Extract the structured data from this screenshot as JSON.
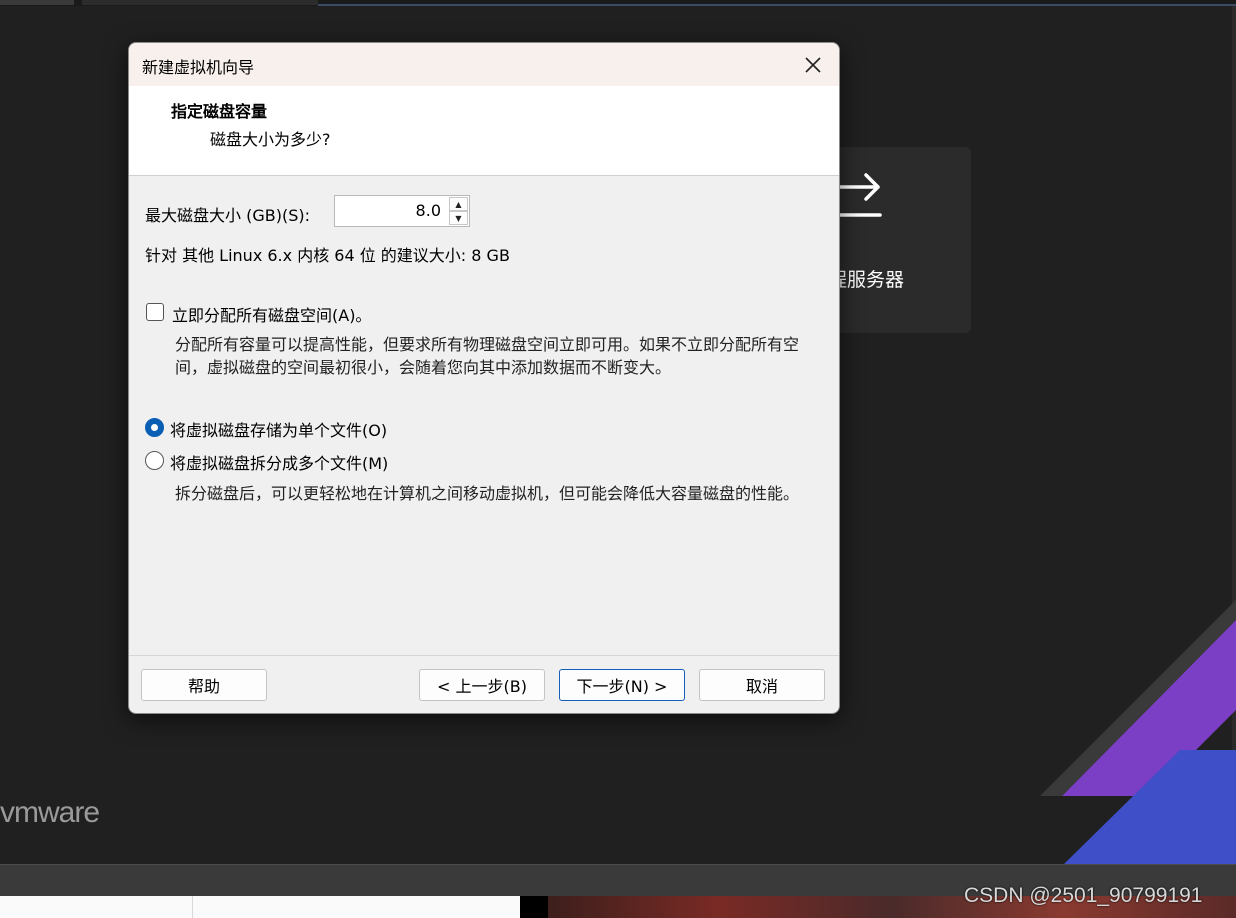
{
  "dialog": {
    "title": "新建虚拟机向导",
    "header_title": "指定磁盘容量",
    "header_subtitle": "磁盘大小为多少?",
    "disk_size_label": "最大磁盘大小 (GB)(S):",
    "disk_size_value": "8.0",
    "recommend_text": "针对 其他 Linux 6.x 内核 64 位 的建议大小: 8 GB",
    "allocate_option": {
      "label": "立即分配所有磁盘空间(A)。",
      "checked": false,
      "description": "分配所有容量可以提高性能，但要求所有物理磁盘空间立即可用。如果不立即分配所有空间，虚拟磁盘的空间最初很小，会随着您向其中添加数据而不断变大。"
    },
    "storage_options": [
      {
        "label": "将虚拟磁盘存储为单个文件(O)",
        "selected": true
      },
      {
        "label": "将虚拟磁盘拆分成多个文件(M)",
        "selected": false
      }
    ],
    "split_description": "拆分磁盘后，可以更轻松地在计算机之间移动虚拟机，但可能会降低大容量磁盘的性能。",
    "buttons": {
      "help": "帮助",
      "back": "< 上一步(B)",
      "next": "下一步(N) >",
      "cancel": "取消"
    }
  },
  "background": {
    "remote_card_label": "程服务器",
    "vmware_logo": "vmware",
    "watermark": "CSDN @2501_90799191"
  },
  "colors": {
    "accent": "#0a5fb4",
    "app_background": "#202020"
  }
}
